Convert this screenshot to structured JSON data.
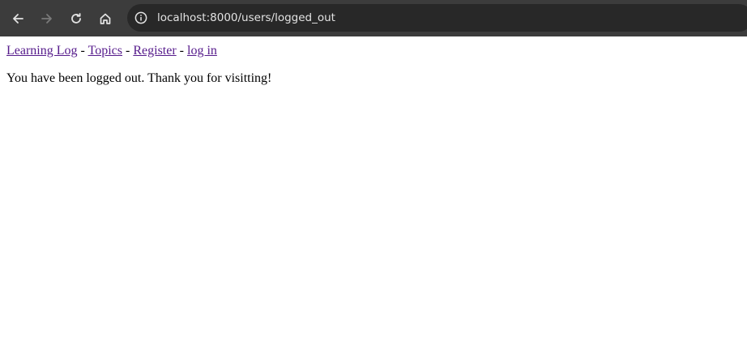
{
  "browser": {
    "url": "localhost:8000/users/logged_out",
    "icons": {
      "back": "arrow-left-icon",
      "forward": "arrow-right-icon",
      "reload": "reload-icon",
      "home": "home-icon",
      "site_info": "info-circle-icon"
    },
    "colors": {
      "toolbar_bg": "#3c3c3c",
      "omnibox_bg": "#282828",
      "icon_active": "#e3e3e3",
      "icon_disabled": "#7a7a7a"
    }
  },
  "page": {
    "nav": {
      "links": [
        {
          "label": "Learning Log"
        },
        {
          "label": "Topics"
        },
        {
          "label": "Register"
        },
        {
          "label": "log in"
        }
      ],
      "separator": "-"
    },
    "message": "You have been logged out. Thank you for visitting!",
    "colors": {
      "link_visited": "#551a8b",
      "text": "#000000",
      "background": "#ffffff"
    }
  }
}
